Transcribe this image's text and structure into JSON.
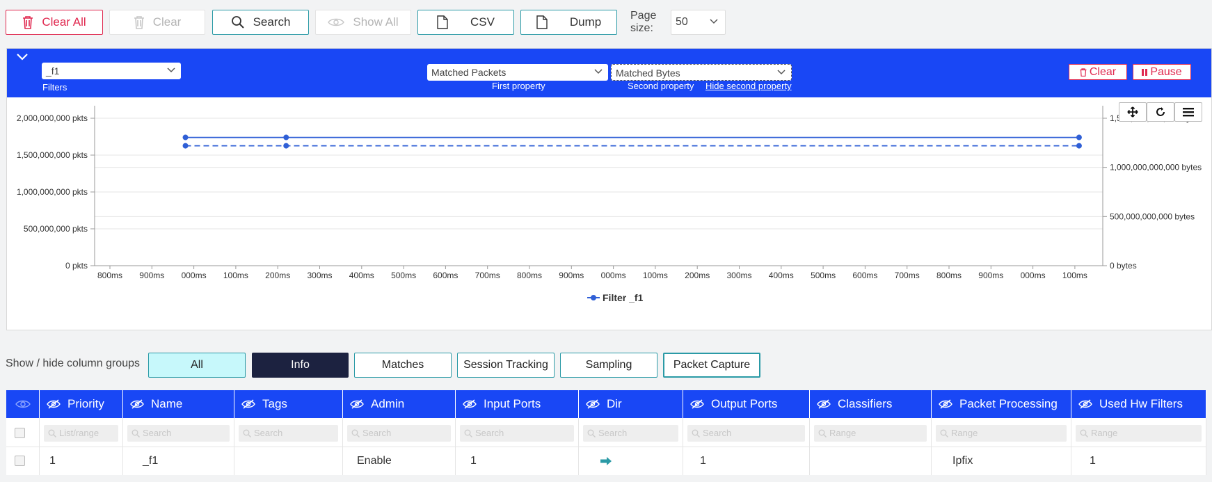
{
  "toolbar": {
    "clear_all": "Clear All",
    "clear": "Clear",
    "search": "Search",
    "show_all": "Show All",
    "csv": "CSV",
    "dump": "Dump",
    "page_size_label_1": "Page",
    "page_size_label_2": "size:",
    "page_size_value": "50"
  },
  "panel": {
    "filter_value": "_f1",
    "filter_label": "Filters",
    "first_property": "Matched Packets",
    "first_property_label": "First property",
    "second_property": "Matched Bytes",
    "second_property_label": "Second property",
    "hide_second": "Hide second property",
    "clear_btn": "Clear",
    "pause_btn": "Pause"
  },
  "chart_data": {
    "type": "line",
    "x": [
      "800ms",
      "900ms",
      "000ms",
      "100ms",
      "200ms",
      "300ms",
      "400ms",
      "500ms",
      "600ms",
      "700ms",
      "800ms",
      "900ms",
      "000ms",
      "100ms",
      "200ms",
      "300ms",
      "400ms",
      "500ms",
      "600ms",
      "700ms",
      "800ms",
      "900ms",
      "000ms",
      "100ms"
    ],
    "y_left_ticks": [
      "2,000,000,000 pkts",
      "1,500,000,000 pkts",
      "1,000,000,000 pkts",
      "500,000,000 pkts",
      "0 pkts"
    ],
    "y_right_ticks": [
      "1,500,000,000,000 bytes",
      "1,000,000,000,000 bytes",
      "500,000,000,000 bytes",
      "0 bytes"
    ],
    "ylim_left": [
      0,
      2000000000
    ],
    "ylim_right": [
      0,
      1500000000000
    ],
    "series": [
      {
        "name": "Filter _f1",
        "axis": "left",
        "style": "solid",
        "points": [
          [
            1.8,
            1740000000
          ],
          [
            4.2,
            1740000000
          ],
          [
            23.1,
            1740000000
          ]
        ]
      },
      {
        "axis": "right",
        "style": "dashed",
        "points": [
          [
            1.8,
            1220000000000
          ],
          [
            4.2,
            1220000000000
          ],
          [
            23.1,
            1220000000000
          ]
        ]
      }
    ],
    "legend": "Filter _f1",
    "color": "#2f5fd6"
  },
  "column_groups": {
    "label": "Show / hide column groups",
    "all": "All",
    "info": "Info",
    "matches": "Matches",
    "session": "Session Tracking",
    "sampling": "Sampling",
    "capture": "Packet Capture"
  },
  "table": {
    "headers": {
      "priority": "Priority",
      "name": "Name",
      "tags": "Tags",
      "admin": "Admin",
      "input_ports": "Input Ports",
      "dir": "Dir",
      "output_ports": "Output Ports",
      "classifiers": "Classifiers",
      "packet_processing": "Packet Processing",
      "used_hw": "Used Hw Filters"
    },
    "placeholders": {
      "priority": "List/range",
      "name": "Search",
      "tags": "Search",
      "admin": "Search",
      "input_ports": "Search",
      "dir": "Search",
      "output_ports": "Search",
      "classifiers": "Range",
      "packet_processing": "Range",
      "used_hw": "Range"
    },
    "row": {
      "priority": "1",
      "name": "_f1",
      "tags": "",
      "admin": "Enable",
      "input_ports": "1",
      "output_ports": "1",
      "classifiers": "",
      "packet_processing": "Ipfix",
      "used_hw": "1"
    }
  }
}
